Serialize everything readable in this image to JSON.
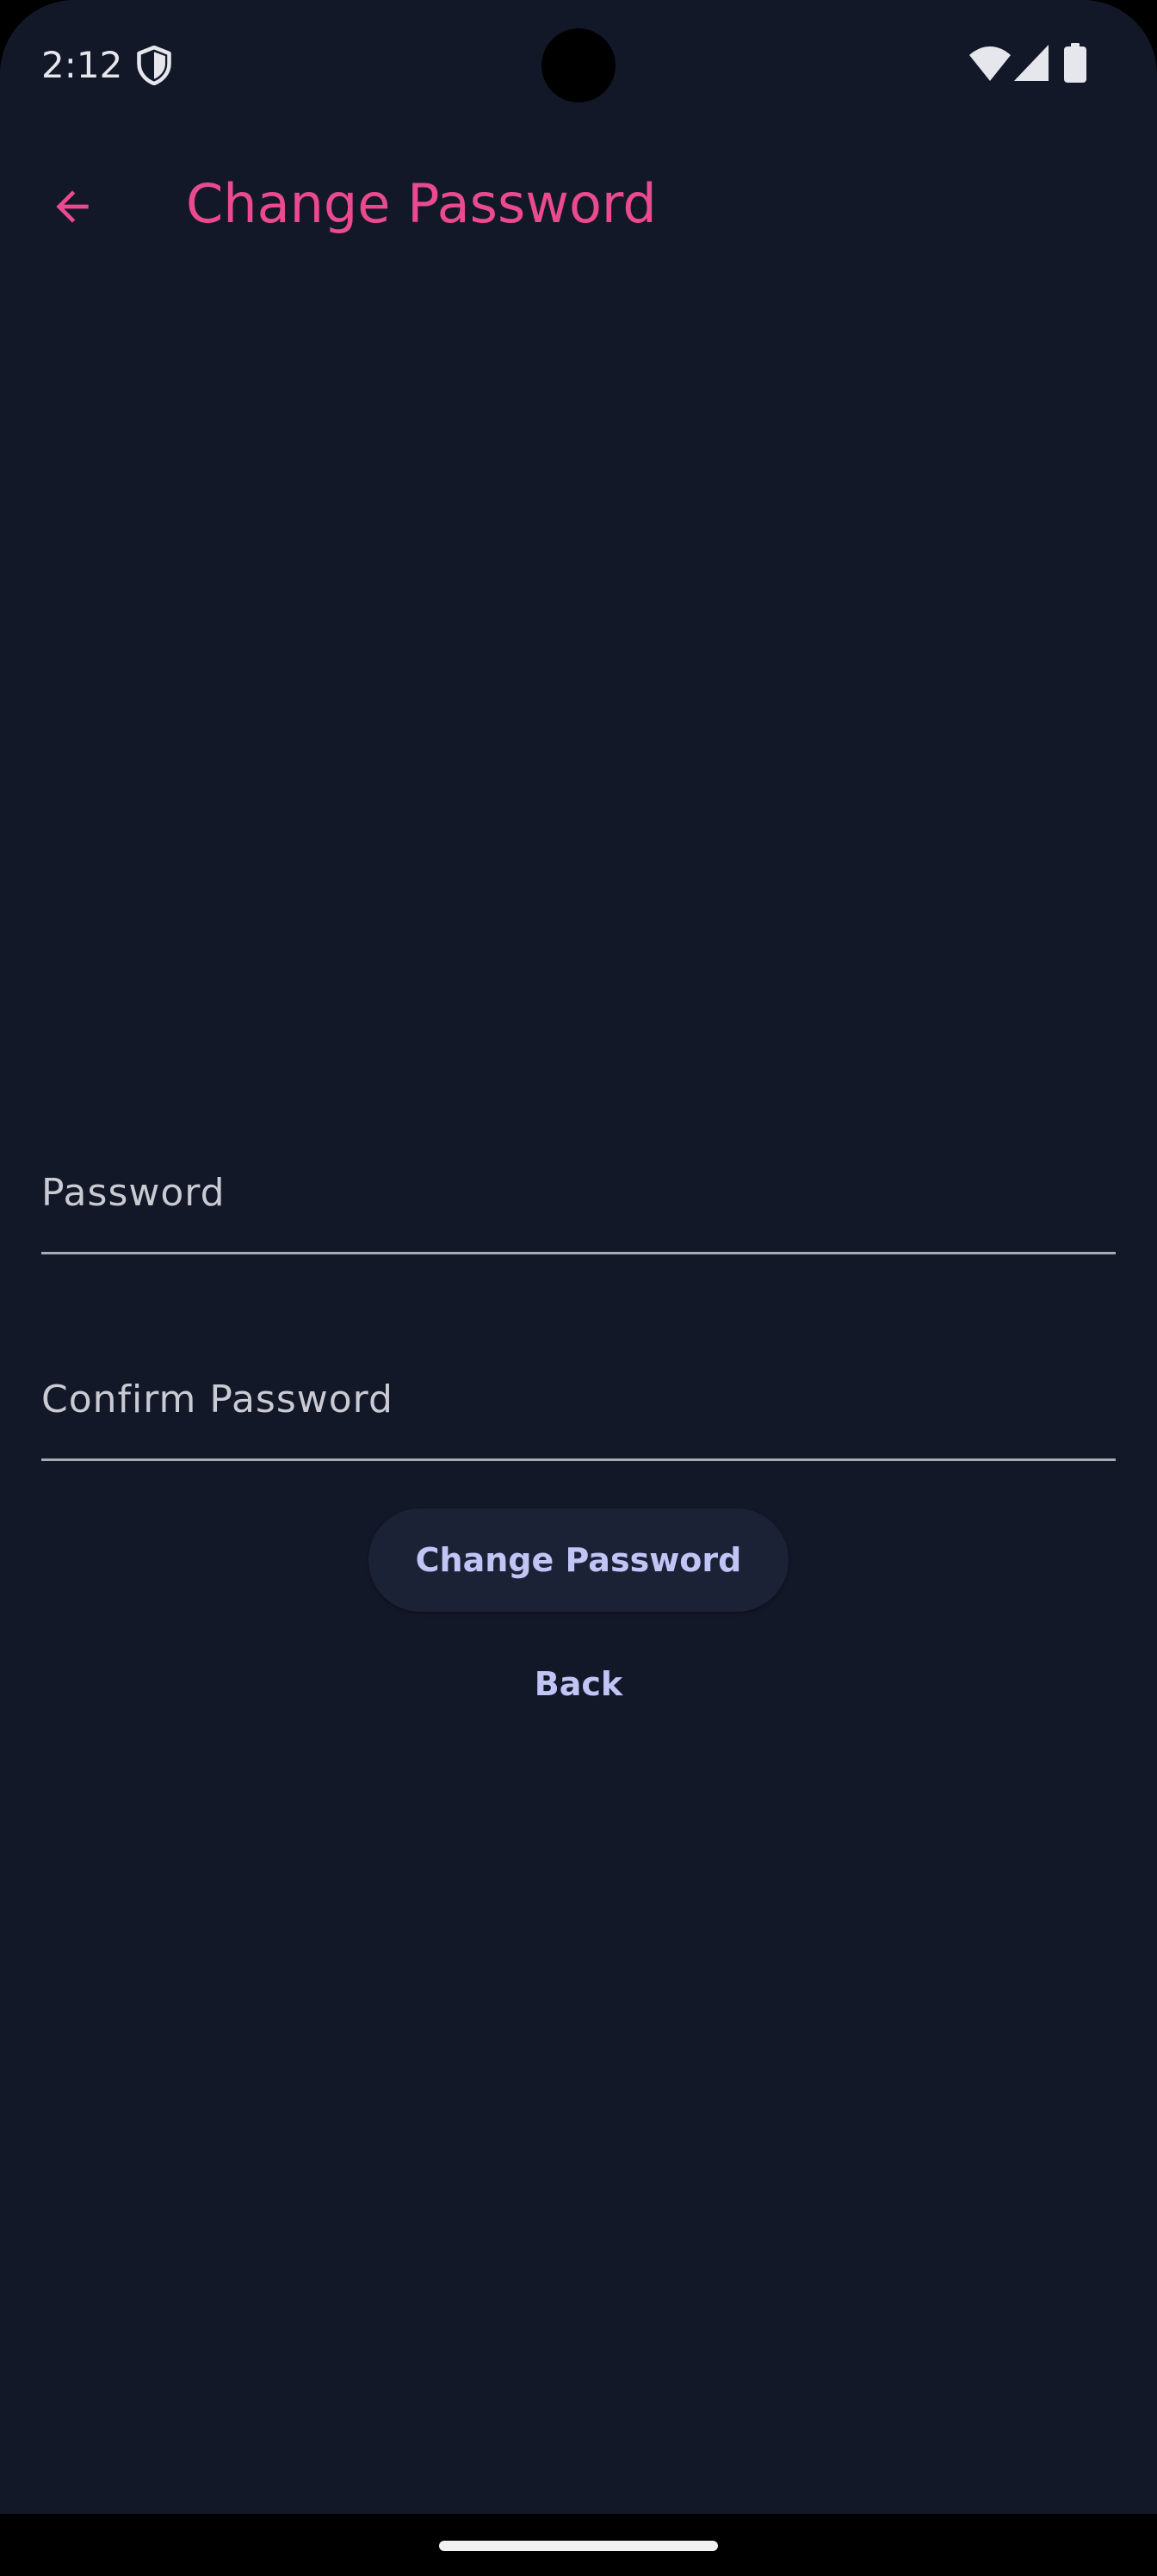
{
  "status_bar": {
    "time": "2:12",
    "icons": [
      "shield-icon",
      "wifi-icon",
      "signal-icon",
      "battery-icon"
    ]
  },
  "app_bar": {
    "back_icon": "arrow-left-icon",
    "title": "Change Password"
  },
  "form": {
    "password": {
      "placeholder": "Password",
      "value": ""
    },
    "confirm_password": {
      "placeholder": "Confirm Password",
      "value": ""
    },
    "submit_label": "Change Password",
    "back_label": "Back"
  },
  "colors": {
    "background": "#131829",
    "accent": "#ea4a8e",
    "button_text": "#c1c5f6",
    "button_bg": "#1c2236",
    "field_line": "#a9abb5"
  }
}
